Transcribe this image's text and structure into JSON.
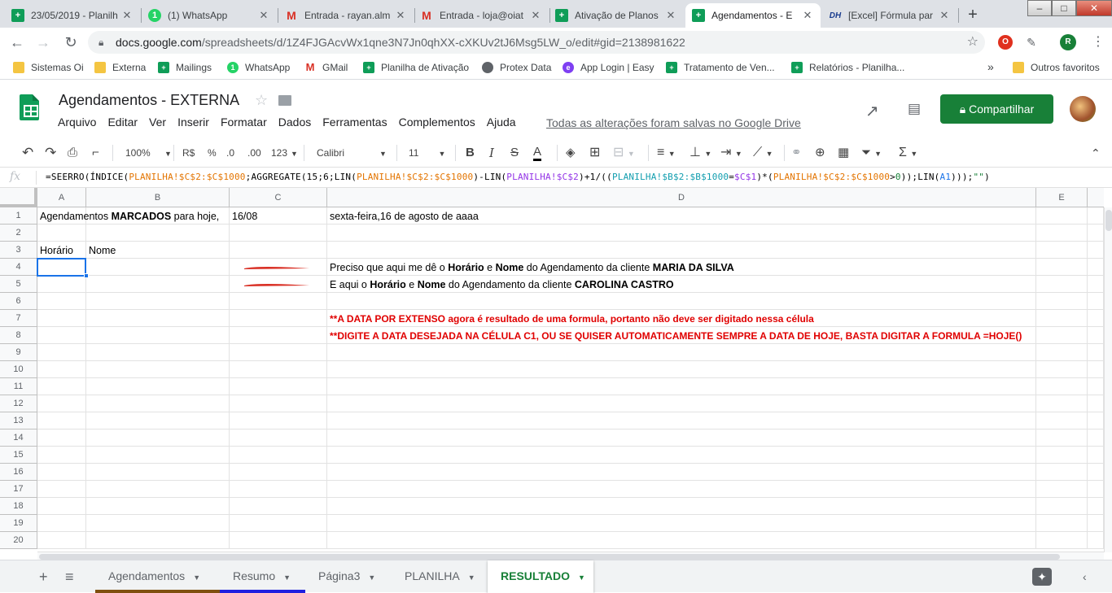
{
  "browser": {
    "tabs": [
      {
        "title": "23/05/2019 - Planilh",
        "icon": "sheets-icon",
        "glyph": "+"
      },
      {
        "title": "(1) WhatsApp",
        "icon": "whatsapp-icon",
        "glyph": "1"
      },
      {
        "title": "Entrada - rayan.alm",
        "icon": "gmail-icon",
        "glyph": "M"
      },
      {
        "title": "Entrada - loja@oiat",
        "icon": "gmail-icon",
        "glyph": "M"
      },
      {
        "title": "Ativação de Planos",
        "icon": "sheets-icon",
        "glyph": "+"
      },
      {
        "title": "Agendamentos - E",
        "icon": "sheets-icon",
        "glyph": "+"
      },
      {
        "title": "[Excel] Fórmula par",
        "icon": "dh-icon",
        "glyph": "DH"
      }
    ],
    "url_host": "docs.google.com",
    "url_path": "/spreadsheets/d/1Z4FJGAcvWx1qne3N7Jn0qhXX-cXKUv2tJ6Msg5LW_o/edit#gid=2138981622",
    "profile_initial": "R",
    "bookmarks": [
      {
        "label": "Sistemas Oi",
        "icon": "folder"
      },
      {
        "label": "Externa",
        "icon": "folder"
      },
      {
        "label": "Mailings",
        "icon": "sheet"
      },
      {
        "label": "WhatsApp",
        "icon": "wa"
      },
      {
        "label": "GMail",
        "icon": "gm"
      },
      {
        "label": "Planilha de Ativação",
        "icon": "sheet"
      },
      {
        "label": "Protex Data",
        "icon": "globe"
      },
      {
        "label": "App Login | Easy",
        "icon": "easy"
      },
      {
        "label": "Tratamento de Ven...",
        "icon": "sheet"
      },
      {
        "label": "Relatórios - Planilha...",
        "icon": "sheet"
      }
    ],
    "bookmarks_more": "»",
    "other_bookmarks": "Outros favoritos"
  },
  "doc": {
    "title": "Agendamentos - EXTERNA",
    "menu": [
      "Arquivo",
      "Editar",
      "Ver",
      "Inserir",
      "Formatar",
      "Dados",
      "Ferramentas",
      "Complementos",
      "Ajuda"
    ],
    "saved_status": "Todas as alterações foram salvas no Google Drive",
    "share_label": "Compartilhar"
  },
  "toolbar": {
    "zoom": "100%",
    "currency": "R$",
    "percent": "%",
    "dec_less": ".0",
    "dec_more": ".00",
    "number_format": "123",
    "font": "Calibri",
    "font_size": "11"
  },
  "formula_bar": {
    "fx": "fx",
    "parts": [
      {
        "t": "=SEERRO(ÍNDICE(",
        "c": ""
      },
      {
        "t": "PLANILHA!$C$2:$C$1000",
        "c": "c-or"
      },
      {
        "t": ";AGGREGATE(15;6;LIN(",
        "c": ""
      },
      {
        "t": "PLANILHA!$C$2:$C$1000",
        "c": "c-or"
      },
      {
        "t": ")-LIN(",
        "c": ""
      },
      {
        "t": "PLANILHA!$C$2",
        "c": "c-pu"
      },
      {
        "t": ")+1/((",
        "c": ""
      },
      {
        "t": "PLANILHA!$B$2:$B$1000",
        "c": "c-te"
      },
      {
        "t": "=",
        "c": ""
      },
      {
        "t": "$C$1",
        "c": "c-pu"
      },
      {
        "t": ")*(",
        "c": ""
      },
      {
        "t": "PLANILHA!$C$2:$C$1000",
        "c": "c-or"
      },
      {
        "t": ">",
        "c": ""
      },
      {
        "t": "0",
        "c": "c-gr"
      },
      {
        "t": "));LIN(",
        "c": ""
      },
      {
        "t": "A1",
        "c": "c-bl"
      },
      {
        "t": ")));",
        "c": ""
      },
      {
        "t": "\"\"",
        "c": "c-gr"
      },
      {
        "t": ")",
        "c": ""
      }
    ]
  },
  "sheet": {
    "columns": [
      "A",
      "B",
      "C",
      "D",
      "E"
    ],
    "rows": [
      "1",
      "2",
      "3",
      "4",
      "5",
      "6",
      "7",
      "8",
      "9",
      "10",
      "11",
      "12",
      "13",
      "14",
      "15",
      "16",
      "17",
      "18",
      "19",
      "20"
    ],
    "cells": {
      "a1_pre": "Agendamentos ",
      "a1_bold": "MARCADOS",
      "a1_post": " para hoje,",
      "c1": "16/08",
      "d1": "sexta-feira,16 de agosto de aaaa",
      "a3": "Horário",
      "b3": "Nome",
      "d4": [
        {
          "t": "Preciso que aqui me dê o ",
          "b": false
        },
        {
          "t": "Horário",
          "b": true
        },
        {
          "t": " e ",
          "b": false
        },
        {
          "t": "Nome",
          "b": true
        },
        {
          "t": " do Agendamento da cliente ",
          "b": false
        },
        {
          "t": "MARIA DA SILVA",
          "b": true
        }
      ],
      "d5": [
        {
          "t": "E aqui o ",
          "b": false
        },
        {
          "t": "Horário",
          "b": true
        },
        {
          "t": " e ",
          "b": false
        },
        {
          "t": "Nome",
          "b": true
        },
        {
          "t": " do Agendamento da cliente ",
          "b": false
        },
        {
          "t": "CAROLINA CASTRO",
          "b": true
        }
      ],
      "d7": "**A DATA POR EXTENSO  agora é resultado de uma formula, portanto não deve ser digitado nessa célula",
      "d8": "**DIGITE A DATA DESEJADA NA CÉLULA C1, OU SE QUISER AUTOMATICAMENTE SEMPRE A DATA DE HOJE, BASTA DIGITAR A FORMULA   =HOJE()"
    }
  },
  "sheet_tabs": [
    {
      "label": "Agendamentos",
      "color": "#7f4f0e",
      "active": false
    },
    {
      "label": "Resumo",
      "color": "#1f1fe0",
      "active": false
    },
    {
      "label": "Página3",
      "color": "",
      "active": false
    },
    {
      "label": "PLANILHA",
      "color": "",
      "active": false
    },
    {
      "label": "RESULTADO",
      "color": "",
      "active": true
    }
  ],
  "colors": {
    "accent": "#188038",
    "selection": "#1a73e8",
    "warning_text": "#e00000"
  }
}
